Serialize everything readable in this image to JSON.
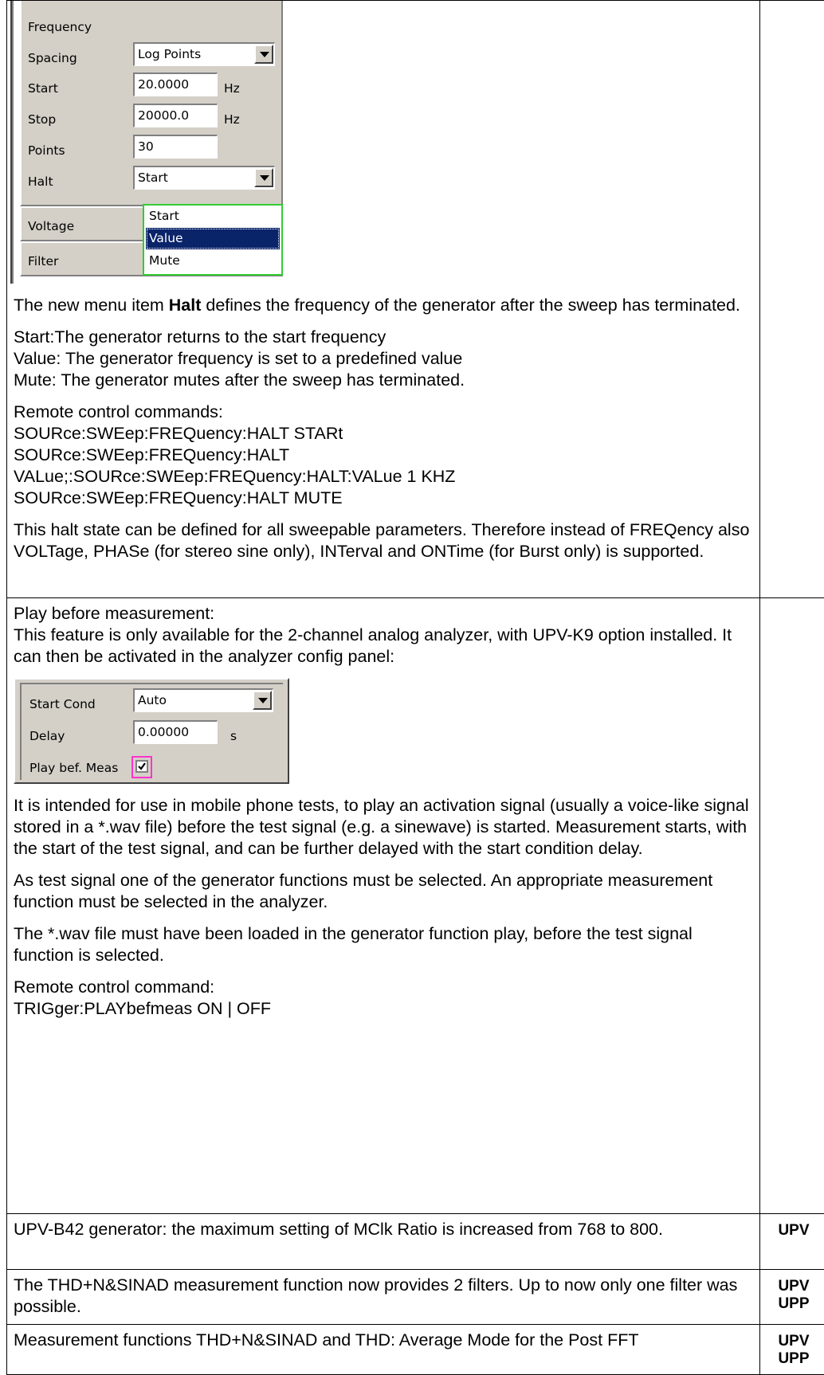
{
  "panel1": {
    "rows": [
      {
        "label": "Frequency"
      },
      {
        "label": "Spacing",
        "value": "Log Points"
      },
      {
        "label": "Start",
        "value": "20.0000",
        "unit": "Hz"
      },
      {
        "label": "Stop",
        "value": "20000.0",
        "unit": "Hz"
      },
      {
        "label": "Points",
        "value": "30"
      },
      {
        "label": "Halt",
        "value": "Start"
      }
    ],
    "voltage_label": "Voltage",
    "filter_label": "Filter",
    "dropdown_options": [
      "Start",
      "Value",
      "Mute"
    ],
    "dropdown_selected": "Value"
  },
  "section1": {
    "p1_pre": "The new menu item ",
    "p1_bold": "Halt",
    "p1_post": " defines the frequency of the generator after the sweep has terminated.",
    "p2_lines": [
      "Start:The generator returns to the start frequency",
      "Value: The generator frequency is set to a predefined value",
      "Mute: The generator mutes after the sweep has terminated."
    ],
    "p3_lines": [
      "Remote control commands:",
      "SOURce:SWEep:FREQuency:HALT STARt",
      "SOURce:SWEep:FREQuency:HALT",
      "VALue;:SOURce:SWEep:FREQuency:HALT:VALue 1 KHZ",
      "SOURce:SWEep:FREQuency:HALT MUTE"
    ],
    "p4": "This halt state can be defined for all sweepable parameters. Therefore instead of FREQency also VOLTage, PHASe (for stereo sine only), INTerval and ONTime (for Burst only) is supported."
  },
  "section2": {
    "intro_lines": [
      "Play before measurement:",
      "This feature is only available for the 2-channel analog analyzer, with UPV-K9 option installed. It can then be activated in the analyzer config panel:"
    ],
    "panel2": {
      "start_cond_label": "Start Cond",
      "start_cond_value": "Auto",
      "delay_label": "Delay",
      "delay_value": "0.00000",
      "delay_unit": "s",
      "play_label": "Play bef. Meas",
      "play_checked": true
    },
    "p2": "It is intended for use in mobile phone tests, to play an activation signal (usually a voice-like signal stored in a *.wav file) before the test signal (e.g. a sinewave) is started. Measurement starts, with the start of the test signal, and can be further delayed with the start condition delay.",
    "p3": "As test signal one of the generator functions must be selected. An appropriate measurement function must be selected in the analyzer.",
    "p4": "The *.wav file must have been loaded in the generator function play, before the test signal function is selected.",
    "p5_lines": [
      "Remote control command:",
      "TRIGger:PLAYbefmeas ON | OFF"
    ]
  },
  "rows": [
    {
      "text": "UPV-B42 generator: the maximum setting of MClk Ratio is increased from 768 to 800.",
      "tags": [
        "UPV"
      ]
    },
    {
      "text": "The THD+N&SINAD measurement function now provides 2 filters. Up to now only one filter was possible.",
      "tags": [
        "UPV",
        "UPP"
      ]
    },
    {
      "text": "Measurement functions THD+N&SINAD and THD: Average Mode for the Post FFT",
      "tags": [
        "UPV",
        "UPP"
      ]
    }
  ]
}
